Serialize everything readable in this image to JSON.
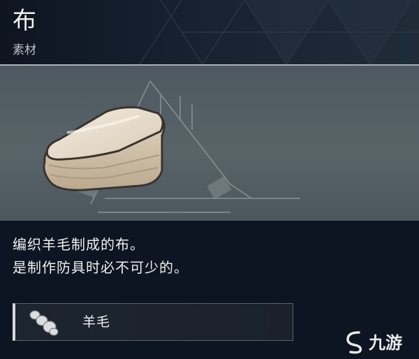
{
  "item": {
    "name": "布",
    "category": "素材"
  },
  "description": {
    "lines": [
      "编织羊毛制成的布。",
      "是制作防具时必不可少的。"
    ]
  },
  "materials": [
    {
      "label": "羊毛",
      "icon": "wool-icon"
    }
  ],
  "watermark": {
    "text": "九游",
    "icon": "jiuyou-logo"
  },
  "colors": {
    "background": "#0d1422",
    "text": "#eef0f0",
    "panel": "#596469",
    "accent_border": "#d7d9da"
  }
}
